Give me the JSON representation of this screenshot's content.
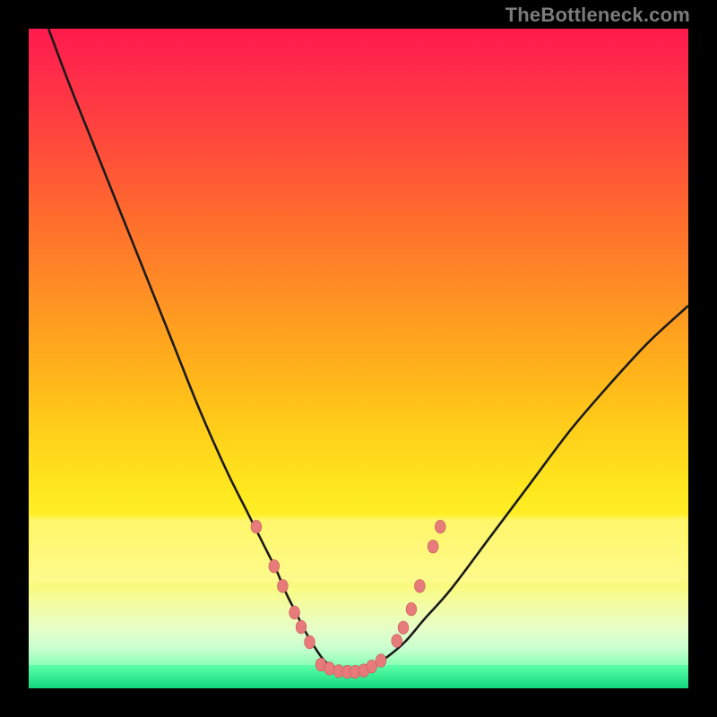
{
  "watermark": "TheBottleneck.com",
  "colors": {
    "dot_fill": "#e77a7a",
    "dot_stroke": "#c95858",
    "curve_stroke": "#1a1a1a"
  },
  "chart_data": {
    "type": "line",
    "title": "",
    "xlabel": "",
    "ylabel": "",
    "xlim": [
      0,
      100
    ],
    "ylim": [
      0,
      100
    ],
    "grid": false,
    "legend": false,
    "series": [
      {
        "name": "bottleneck-curve",
        "x": [
          3,
          6,
          10,
          14,
          18,
          22,
          26,
          30,
          33,
          35.5,
          37.5,
          39,
          40.5,
          42,
          43.5,
          45,
          46.5,
          48,
          49.5,
          51.5,
          54,
          57,
          60,
          64,
          70,
          76,
          82,
          88,
          94,
          100
        ],
        "y": [
          100,
          92,
          82,
          72,
          62,
          52,
          42,
          33,
          27,
          22,
          18,
          14.5,
          11.5,
          8.5,
          6,
          4,
          3,
          2.5,
          2.5,
          3,
          4.5,
          7,
          10.5,
          15,
          23,
          31,
          39,
          46,
          52.5,
          58
        ]
      }
    ],
    "dots": {
      "name": "marker-points",
      "points": [
        {
          "x": 34.5,
          "y": 24.5
        },
        {
          "x": 37.2,
          "y": 18.5
        },
        {
          "x": 38.5,
          "y": 15.5
        },
        {
          "x": 40.3,
          "y": 11.5
        },
        {
          "x": 41.3,
          "y": 9.3
        },
        {
          "x": 42.6,
          "y": 7.0
        },
        {
          "x": 44.3,
          "y": 3.6
        },
        {
          "x": 45.6,
          "y": 3.0
        },
        {
          "x": 47.0,
          "y": 2.6
        },
        {
          "x": 48.3,
          "y": 2.5
        },
        {
          "x": 49.5,
          "y": 2.5
        },
        {
          "x": 50.8,
          "y": 2.7
        },
        {
          "x": 52.0,
          "y": 3.3
        },
        {
          "x": 53.4,
          "y": 4.2
        },
        {
          "x": 55.8,
          "y": 7.2
        },
        {
          "x": 56.8,
          "y": 9.2
        },
        {
          "x": 58.0,
          "y": 12.0
        },
        {
          "x": 59.3,
          "y": 15.5
        },
        {
          "x": 61.3,
          "y": 21.5
        },
        {
          "x": 62.4,
          "y": 24.5
        }
      ],
      "radius_pct": 0.95
    }
  }
}
